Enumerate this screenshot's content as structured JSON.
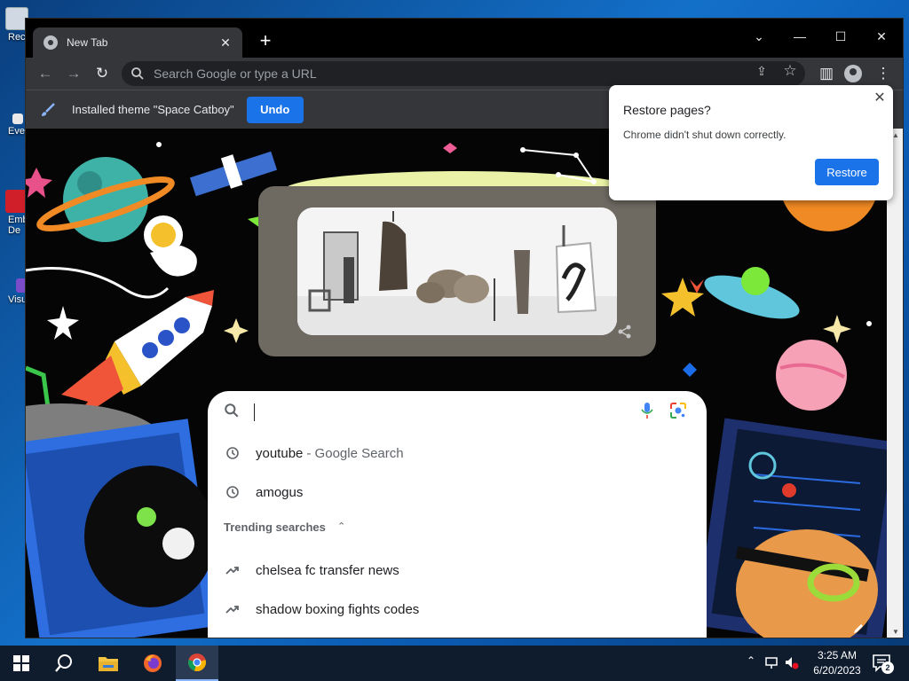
{
  "desktop": {
    "icons": [
      {
        "label": "Rec",
        "name": "recycle-bin"
      },
      {
        "label": "Eve",
        "name": "everything"
      },
      {
        "label": "Emb",
        "name": "embarcadero"
      },
      {
        "label": "De",
        "name": "embarcadero-2"
      },
      {
        "label": "Visu",
        "name": "visual-studio"
      }
    ]
  },
  "browser": {
    "tab": {
      "title": "New Tab",
      "close": "✕"
    },
    "new_tab": "+",
    "window_controls": {
      "tabsearch": "⌄",
      "minimize": "—",
      "maximize": "☐",
      "close": "✕"
    },
    "toolbar": {
      "back": "←",
      "forward": "→",
      "reload": "↻",
      "omnibox_placeholder": "Search Google or type a URL",
      "share": "⇪",
      "bookmark": "☆",
      "side_panel": "▥",
      "menu": "⋮"
    },
    "infobar": {
      "message": "Installed theme \"Space Catboy\"",
      "undo_label": "Undo"
    }
  },
  "ntp": {
    "search": {
      "placeholder": "",
      "suggestions": [
        {
          "icon": "history-icon",
          "text": "youtube",
          "suffix": "- Google Search"
        },
        {
          "icon": "history-icon",
          "text": "amogus",
          "suffix": ""
        }
      ],
      "trending_header": "Trending searches",
      "trending_chevron": "⌃",
      "trending": [
        {
          "icon": "trending-icon",
          "text": "chelsea fc transfer news"
        },
        {
          "icon": "trending-icon",
          "text": "shadow boxing fights codes"
        }
      ]
    }
  },
  "restore_popup": {
    "title": "Restore pages?",
    "message": "Chrome didn't shut down correctly.",
    "button": "Restore",
    "close": "✕"
  },
  "taskbar": {
    "clock_time": "3:25 AM",
    "clock_date": "6/20/2023",
    "notification_count": "2",
    "tray_chevron": "⌃"
  },
  "colors": {
    "accent": "#1a73e8",
    "chrome_dark": "#35363a",
    "tabstrip": "#000000",
    "taskbar": "#0f1c2e"
  }
}
